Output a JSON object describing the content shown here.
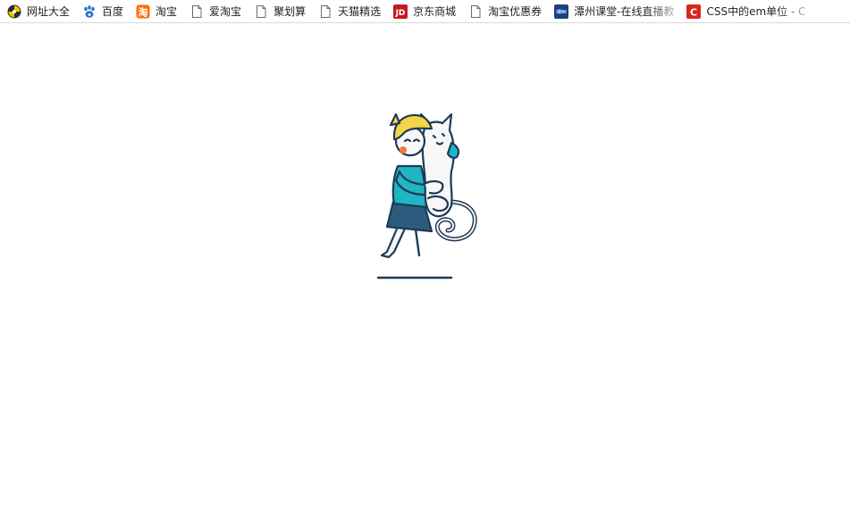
{
  "bookmarks": [
    {
      "label": "网址大全",
      "icon": "hao123-icon"
    },
    {
      "label": "百度",
      "icon": "baidu-paw-icon"
    },
    {
      "label": "淘宝",
      "icon": "taobao-icon"
    },
    {
      "label": "爱淘宝",
      "icon": "page-icon"
    },
    {
      "label": "聚划算",
      "icon": "page-icon"
    },
    {
      "label": "天猫精选",
      "icon": "page-icon"
    },
    {
      "label": "京东商城",
      "icon": "jd-icon"
    },
    {
      "label": "淘宝优惠券",
      "icon": "page-icon"
    },
    {
      "label": "潭州课堂-在线直播教",
      "icon": "tanzhou-icon"
    },
    {
      "label": "CSS中的em单位 - C",
      "icon": "csdn-icon"
    }
  ],
  "colors": {
    "hair": "#f5d547",
    "shirt": "#1fb5c4",
    "skirt": "#2c5b7e",
    "outline": "#1e3a55",
    "cheek": "#f07a3a",
    "cat": "#f7f7f7"
  }
}
